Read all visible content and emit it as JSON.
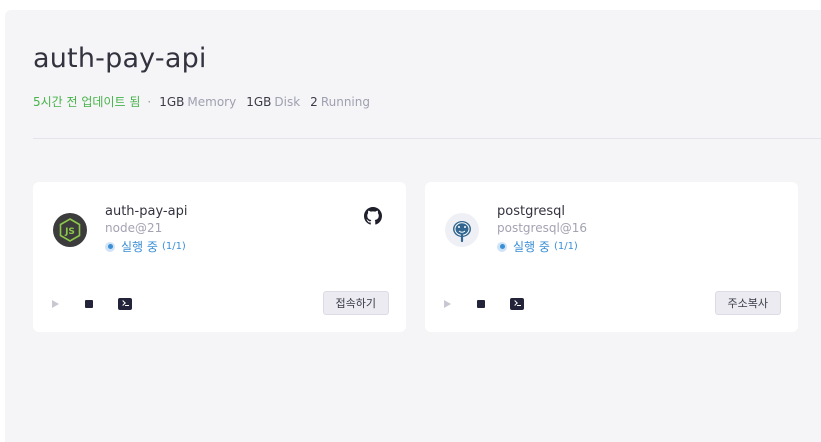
{
  "project": {
    "title": "auth-pay-api",
    "updated": "5시간 전 업데이트 됨",
    "separator": "·",
    "memory_value": "1GB",
    "memory_label": "Memory",
    "disk_value": "1GB",
    "disk_label": "Disk",
    "running_value": "2",
    "running_label": "Running"
  },
  "services": [
    {
      "name": "auth-pay-api",
      "image": "node@21",
      "status": "실행 중",
      "count": "(1/1)",
      "icon": "nodejs-icon",
      "action_label": "접속하기"
    },
    {
      "name": "postgresql",
      "image": "postgresql@16",
      "status": "실행 중",
      "count": "(1/1)",
      "icon": "postgresql-icon",
      "action_label": "주소복사"
    }
  ],
  "colors": {
    "updated": "#47b34a",
    "status": "#3a8fd6",
    "node_bg": "#3c3c3c",
    "node_green": "#8cc84b"
  }
}
